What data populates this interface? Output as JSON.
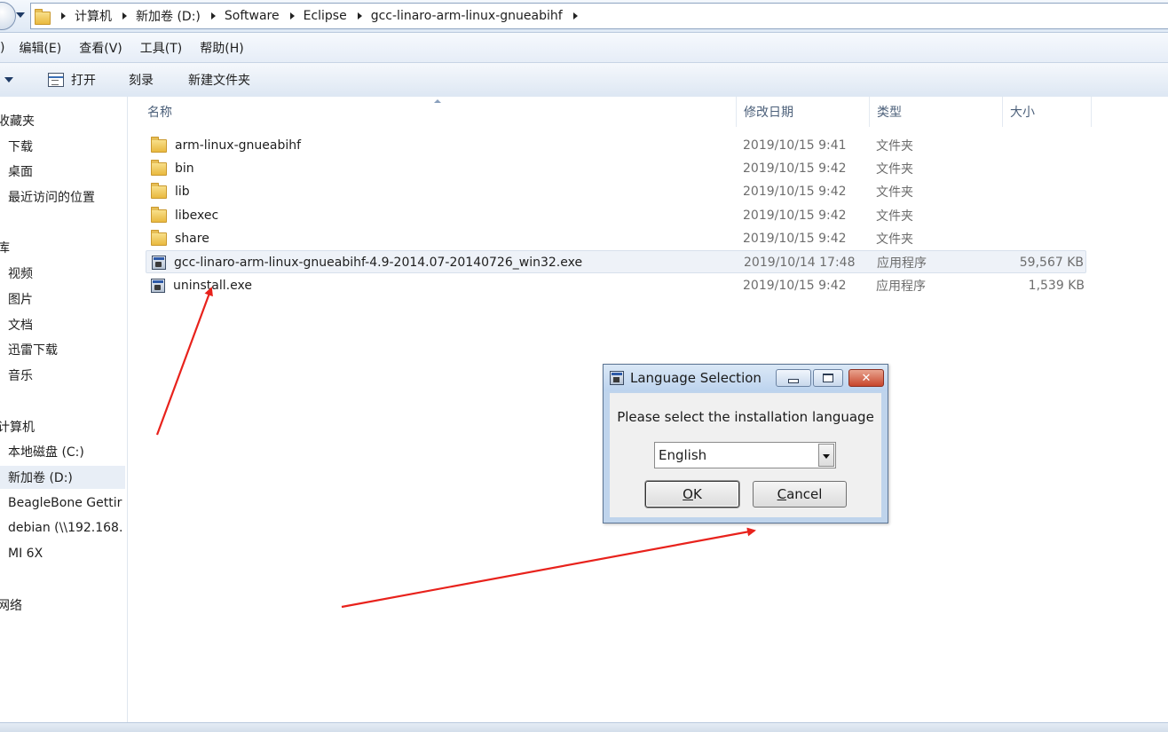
{
  "address_bar": {
    "crumbs": [
      "计算机",
      "新加卷 (D:)",
      "Software",
      "Eclipse",
      "gcc-linaro-arm-linux-gnueabihf"
    ]
  },
  "menu": {
    "items": [
      ")",
      "编辑(E)",
      "查看(V)",
      "工具(T)",
      "帮助(H)"
    ]
  },
  "toolbar": {
    "open_label": "打开",
    "burn_label": "刻录",
    "new_folder_label": "新建文件夹"
  },
  "sidebar": {
    "items": [
      {
        "label": "收藏夹"
      },
      {
        "label": "下载"
      },
      {
        "label": "桌面"
      },
      {
        "label": "最近访问的位置"
      },
      {
        "label": "库"
      },
      {
        "label": "视频"
      },
      {
        "label": "图片"
      },
      {
        "label": "文档"
      },
      {
        "label": "迅雷下载"
      },
      {
        "label": "音乐"
      },
      {
        "label": "计算机"
      },
      {
        "label": "本地磁盘 (C:)"
      },
      {
        "label": "新加卷 (D:)"
      },
      {
        "label": "BeagleBone Gettir"
      },
      {
        "label": "debian (\\\\192.168."
      },
      {
        "label": "MI 6X"
      },
      {
        "label": "网络"
      }
    ]
  },
  "columns": {
    "name": "名称",
    "date": "修改日期",
    "type": "类型",
    "size": "大小"
  },
  "files": [
    {
      "name": "arm-linux-gnueabihf",
      "date": "2019/10/15 9:41",
      "type": "文件夹",
      "size": "",
      "icon": "folder-icon"
    },
    {
      "name": "bin",
      "date": "2019/10/15 9:42",
      "type": "文件夹",
      "size": "",
      "icon": "folder-icon"
    },
    {
      "name": "lib",
      "date": "2019/10/15 9:42",
      "type": "文件夹",
      "size": "",
      "icon": "folder-icon"
    },
    {
      "name": "libexec",
      "date": "2019/10/15 9:42",
      "type": "文件夹",
      "size": "",
      "icon": "folder-icon"
    },
    {
      "name": "share",
      "date": "2019/10/15 9:42",
      "type": "文件夹",
      "size": "",
      "icon": "folder-icon"
    },
    {
      "name": "gcc-linaro-arm-linux-gnueabihf-4.9-2014.07-20140726_win32.exe",
      "date": "2019/10/14 17:48",
      "type": "应用程序",
      "size": "59,567 KB",
      "icon": "exe-icon"
    },
    {
      "name": "uninstall.exe",
      "date": "2019/10/15 9:42",
      "type": "应用程序",
      "size": "1,539 KB",
      "icon": "exe-icon"
    }
  ],
  "dialog": {
    "title": "Language Selection",
    "prompt": "Please select the installation language",
    "language_selected": "English",
    "ok_accel": "O",
    "ok_rest": "K",
    "cancel_accel": "C",
    "cancel_rest": "ancel",
    "close_glyph": "✕"
  },
  "colors": {
    "annotation_arrow": "#e8221c",
    "window_frame": "#bfd4ec"
  }
}
